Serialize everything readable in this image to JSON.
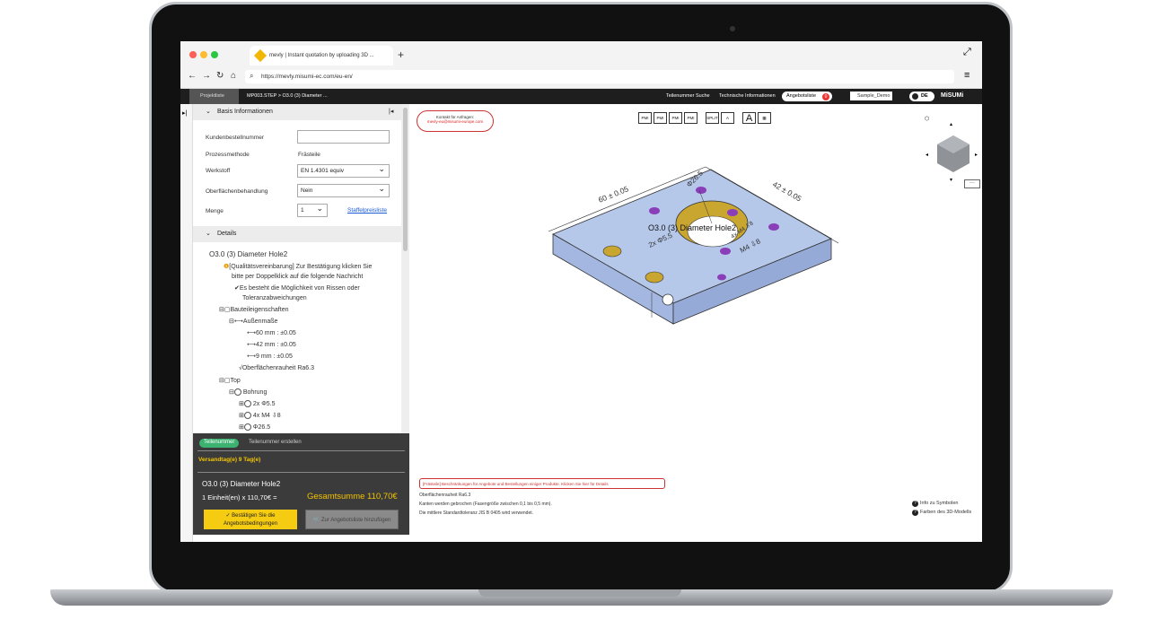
{
  "browser": {
    "tab_title": "mevly | Instant quotation by uploading 3D ...",
    "url": "https://mevly.misumi-ec.com/eu-en/"
  },
  "toolbar": {
    "projects": "Projektliste",
    "breadcrumb": "MP003.STEP > O3.0 (3) Diameter ...",
    "part_search": "Teilenummer Suche",
    "tech_info": "Technische Informationen",
    "quote_list": "Angebotsliste",
    "quote_count": "0",
    "sample": "Sample_Demo",
    "lang": "DE",
    "brand": "MiSUMi"
  },
  "basis": {
    "title": "Basis Informationen",
    "rows": [
      {
        "label": "Kundenbestellnummer",
        "value": ""
      },
      {
        "label": "Prozessmethode",
        "value": "Frästeile"
      },
      {
        "label": "Werkstoff",
        "value": "EN 1.4301 equiv"
      },
      {
        "label": "Oberflächenbehandlung",
        "value": "Nein"
      },
      {
        "label": "Menge",
        "value": "1"
      }
    ],
    "staffel": "Staffelpreisliste"
  },
  "details": {
    "title": "Details",
    "tree": [
      "O3.0 (3) Diameter Hole2",
      "[Qualitätsvereinbarung] Zur Bestätigung klicken Sie",
      "bitte per Doppelklick auf die folgende Nachricht",
      "Es besteht die Möglichkeit von Rissen oder",
      "Toleranzabweichungen",
      "Bauteileigenschaften",
      "Außenmaße",
      "60 mm : ±0.05",
      "42 mm : ±0.05",
      "9 mm : ±0.05",
      "Oberflächenrauheit Ra6.3",
      "Top",
      "Bohrung",
      "2x Φ5.5",
      "4x M4 ⇩8",
      "Φ26.5"
    ]
  },
  "bottom": {
    "tab_active": "Teilenummer",
    "tab_other": "Teilenummer erstellen",
    "delivery": "Versandtag(e) 9 Tag(e)",
    "name": "O3.0 (3) Diameter Hole2",
    "qty_price": "1 Einheit(en)  x 110,70€ =",
    "total": "Gesamtsumme 110,70€",
    "confirm": "Bestätigen Sie die Angebotsbedingungen",
    "add": "Zur Angebotsliste hinzufügen"
  },
  "viewer": {
    "contact_title": "Kontakt für Anfragen:",
    "contact_mail": "mevly-eu@misumi-europe.com",
    "icons": [
      "PMI",
      "PMI",
      "PMI",
      "PMI",
      "SPLIT",
      "A"
    ],
    "dims": {
      "len": "60 ± 0.05",
      "wid": "42 ± 0.05",
      "hole": "Φ26.5",
      "holes2": "2x Φ5.5",
      "m4": "4x M4 ⇩8",
      "m4b": "M4 ⇩8"
    },
    "part_label": "O3.0 (3) Diameter Hole2",
    "warning": "[Frästeile] Beschränkungen für Angebote und Bestellungen einiger Produkte. Klicken Sie hier für Details",
    "notes": [
      "Oberflächenrauheit Ra6.3",
      "Kanten werden gebrochen (Fasengröße zwischen 0,1 bis 0,5 mm).",
      "Die mittlere Standardtoleranz JIS B 0405 wird verwendet."
    ],
    "help": [
      "Info zu Symbolen",
      "Farben des 3D-Modells"
    ],
    "more": "···"
  }
}
